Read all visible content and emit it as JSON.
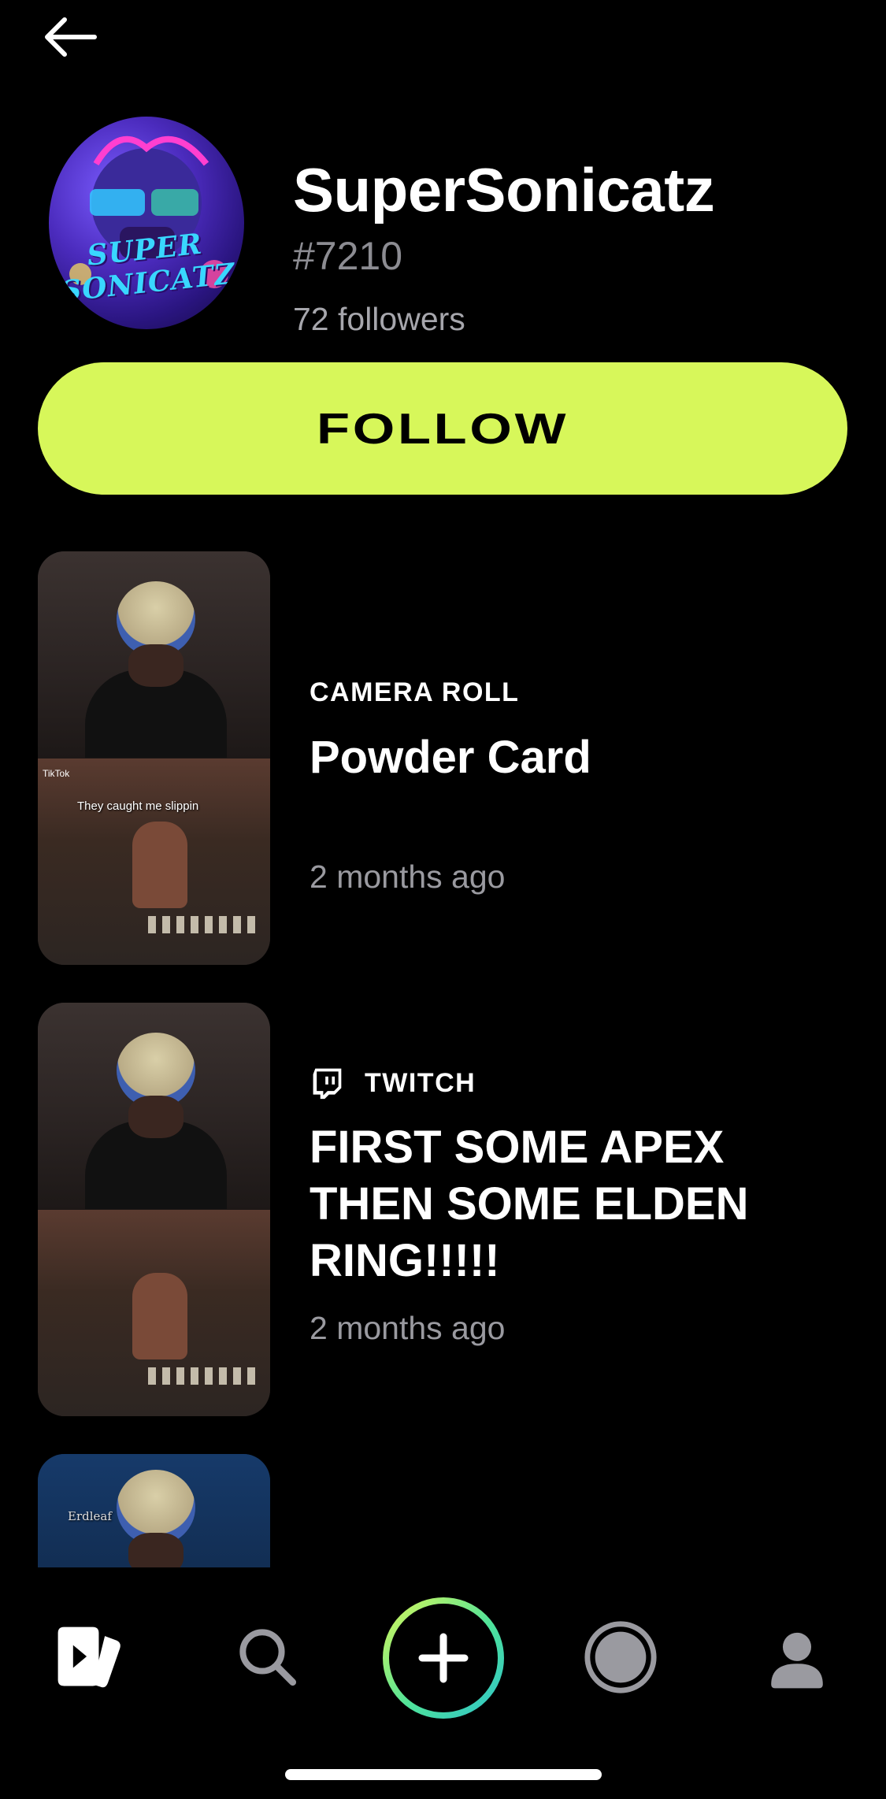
{
  "header": {
    "back_icon": "arrow-left-icon"
  },
  "profile": {
    "avatar_text": "SUPER SONICATZ",
    "username": "SuperSonicatz",
    "tag": "#7210",
    "followers": "72 followers"
  },
  "follow_button": {
    "label": "FOLLOW",
    "color": "#d7f75a"
  },
  "feed": [
    {
      "source_label": "CAMERA ROLL",
      "source_icon": "",
      "title": "Powder Card",
      "time": "2 months ago",
      "thumb_caption": "They caught me slippin",
      "thumb_badge": "TikTok"
    },
    {
      "source_label": "TWITCH",
      "source_icon": "twitch-icon",
      "title": "FIRST SOME APEX THEN SOME ELDEN RING!!!!!",
      "time": "2 months ago"
    },
    {
      "thumb_caption": "Erdleaf"
    }
  ],
  "tab_bar": {
    "items": [
      "clips-icon",
      "search-icon",
      "create-icon",
      "record-icon",
      "profile-icon"
    ]
  }
}
